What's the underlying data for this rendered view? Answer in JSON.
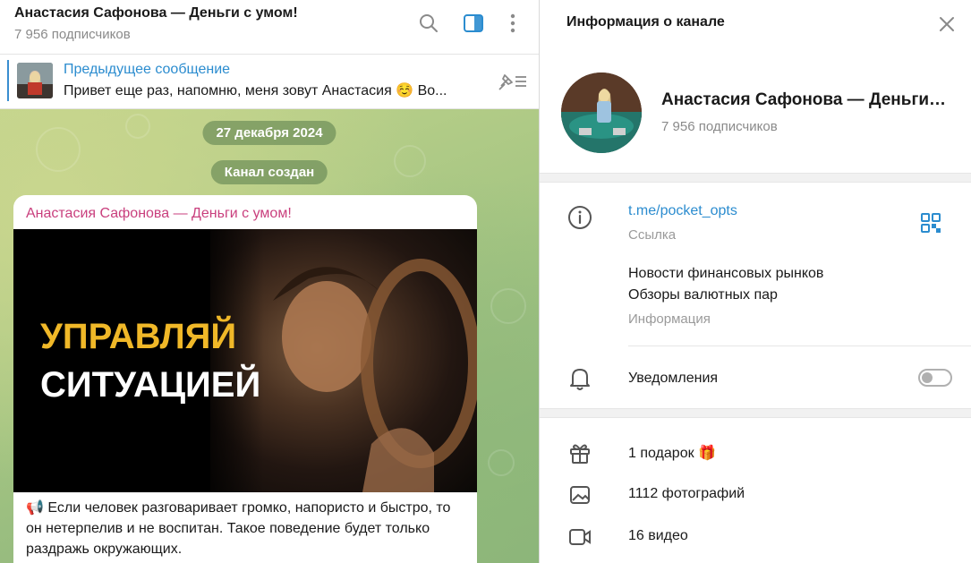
{
  "chat_header": {
    "title": "Анастасия Сафонова — Деньги с умом!",
    "subscribers": "7 956 подписчиков"
  },
  "pinned": {
    "title": "Предыдущее сообщение",
    "text": "Привет еще раз, напомню, меня зовут Анастасия ☺️ Во..."
  },
  "service": {
    "date": "27 декабря 2024",
    "created": "Канал создан"
  },
  "message": {
    "author": "Анастасия Сафонова — Деньги с умом!",
    "image_line1": "УПРАВЛЯЙ",
    "image_line2": "СИТУАЦИЕЙ",
    "text": "📢 Если человек разговаривает громко, напористо и быстро, то он нетерпелив и не воспитан. Такое поведение будет только раздражь окружающих."
  },
  "info_panel": {
    "title": "Информация о канале",
    "name": "Анастасия Сафонова — Деньги с умом!",
    "subscribers": "7 956 подписчиков",
    "link": "t.me/pocket_opts",
    "link_label": "Ссылка",
    "description_line1": "Новости финансовых рынков",
    "description_line2": "Обзоры валютных пар",
    "description_label": "Информация",
    "notifications": "Уведомления",
    "notifications_on": false,
    "gifts": "1 подарок 🎁",
    "photos": "1112 фотографий",
    "videos": "16 видео"
  },
  "colors": {
    "accent": "#2b8ccf",
    "author": "#c93f7d",
    "image_highlight": "#f0b828"
  }
}
